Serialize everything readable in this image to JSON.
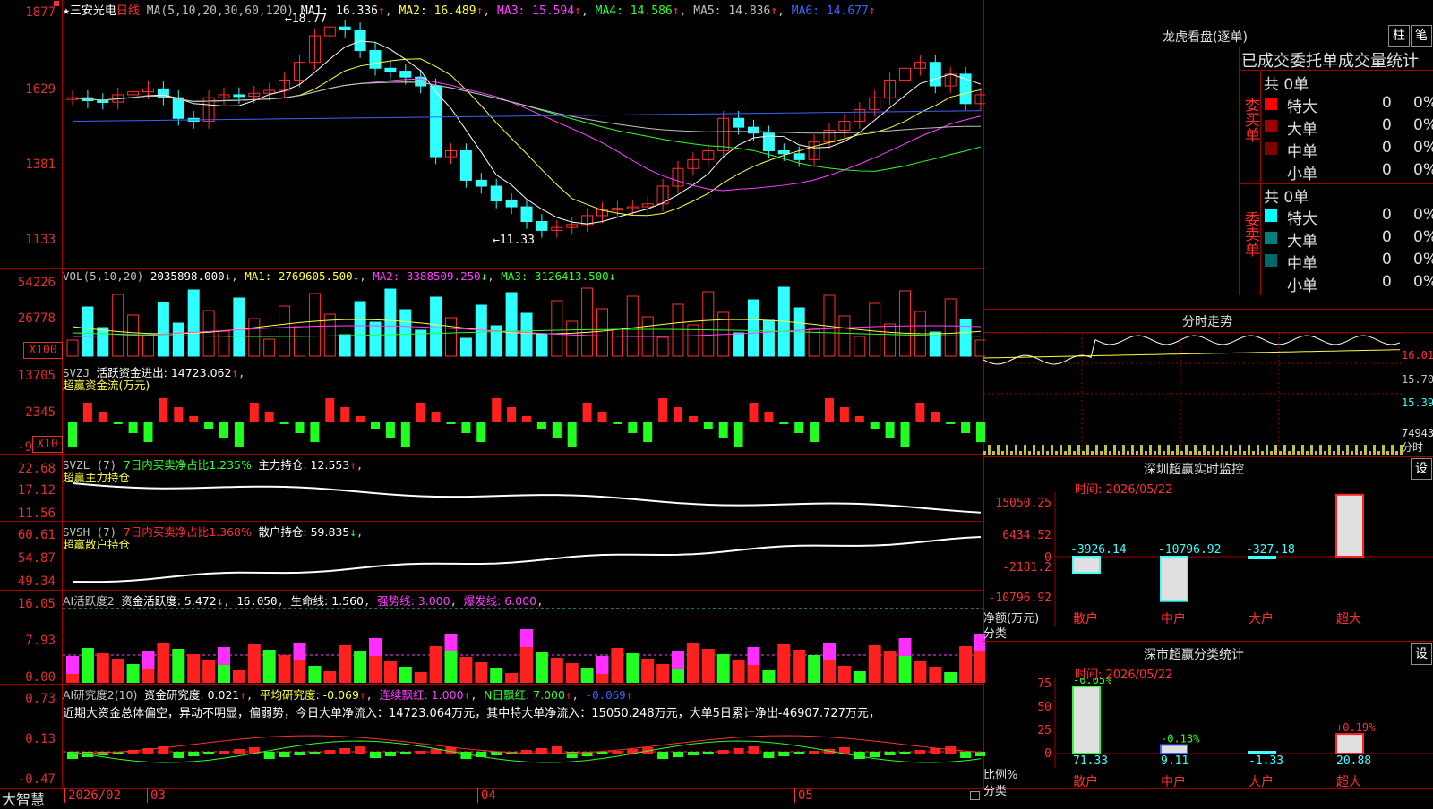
{
  "stock": {
    "name": "三安光电",
    "period": "日线",
    "ma_params": "MA(5,10,20,30,60,120)",
    "ma1": "MA1: 16.336",
    "ma2": "MA2: 16.489",
    "ma3": "MA3: 15.594",
    "ma4": "MA4: 14.586",
    "ma5": "MA5: 14.836",
    "ma6": "MA6: 14.677",
    "high_mark": "18.77",
    "low_mark": "11.33",
    "up_arrow": "↑",
    "down_arrow": "↓"
  },
  "price_axis": [
    "1877",
    "1629",
    "1381",
    "1133"
  ],
  "vol": {
    "params": "VOL(5,10,20)",
    "value": "2035898.000",
    "ma1": "MA1: 2769605.500",
    "ma2": "MA2: 3388509.250",
    "ma3": "MA3: 3126413.500",
    "axis": [
      "54226",
      "26778"
    ],
    "unit": "X100"
  },
  "svzj": {
    "title": "SVZJ",
    "label": "活跃资金进出: 14723.062",
    "sub": "超赢资金流(万元)",
    "axis": [
      "13705",
      "2345",
      "-9"
    ],
    "unit": "X10"
  },
  "svzl": {
    "title": "SVZL (7)",
    "label1": "7日内买卖净占比1.235%",
    "label2": "主力持仓: 12.553",
    "sub": "超赢主力持仓",
    "axis": [
      "22.68",
      "17.12",
      "11.56"
    ]
  },
  "svsh": {
    "title": "SVSH (7)",
    "label1": "7日内买卖净占比1.368%",
    "label2": "散户持仓: 59.835",
    "sub": "超赢散户持仓",
    "axis": [
      "60.61",
      "54.87",
      "49.34"
    ]
  },
  "ai2": {
    "title": "AI活跃度2",
    "label1": "资金活跃度: 5.472",
    "label2": "16.050",
    "label3": "生命线: 1.560",
    "label4": "强势线: 3.000",
    "label5": "爆发线: 6.000",
    "axis": [
      "16.05",
      "7.93",
      "0.00"
    ]
  },
  "ai_res": {
    "title": "AI研究度2(10)",
    "label1": "资金研究度: 0.021",
    "label2": "平均研究度: -0.069",
    "label3": "连续飘红: 1.000",
    "label4": "N日飘红: 7.000",
    "label5": "-0.069",
    "comment": "近期大资金总体偏空，异动不明显，偏弱势，今日大单净流入：14723.064万元，其中特大单净流入：15050.248万元，大单5日累计净出-46907.727万元，",
    "axis": [
      "0.73",
      "0.13",
      "-0.47"
    ]
  },
  "time_axis": {
    "brand": "大智慧",
    "labels": [
      "2026/02",
      "03",
      "04",
      "05"
    ]
  },
  "dragon": {
    "title": "龙虎看盘(逐单)",
    "btn_bar": "柱",
    "btn_pen": "笔",
    "tabs": [
      "已成交",
      "委托单",
      "成交量统计"
    ],
    "buy": {
      "side": "委买单",
      "total": "共 0单",
      "rows": [
        {
          "name": "特大",
          "count": "0",
          "pct": "0%"
        },
        {
          "name": "大单",
          "count": "0",
          "pct": "0%"
        },
        {
          "name": "中单",
          "count": "0",
          "pct": "0%"
        },
        {
          "name": "小单",
          "count": "0",
          "pct": "0%"
        }
      ]
    },
    "sell": {
      "side": "委卖单",
      "total": "共 0单",
      "rows": [
        {
          "name": "特大",
          "count": "0",
          "pct": "0%"
        },
        {
          "name": "大单",
          "count": "0",
          "pct": "0%"
        },
        {
          "name": "中单",
          "count": "0",
          "pct": "0%"
        },
        {
          "name": "小单",
          "count": "0",
          "pct": "0%"
        }
      ]
    },
    "colors": {
      "buy_xl": "#ff0000",
      "buy_l": "#a00000",
      "buy_m": "#800000",
      "sell_xl": "#00ffff",
      "sell_l": "#008080",
      "sell_m": "#006868"
    }
  },
  "intraday": {
    "title": "分时走势",
    "axis": [
      "16.01",
      "15.70",
      "15.39",
      "74943"
    ],
    "unit": "分时"
  },
  "sz_monitor": {
    "title": "深圳超赢实时监控",
    "btn": "设",
    "time": "时间: 2026/05/22",
    "axis": [
      "15050.25",
      "6434.52",
      "0",
      "-2181.2",
      "-10796.92"
    ],
    "axis_title": "净额(万元)",
    "axis_sub": "分类",
    "bars": [
      {
        "cat": "散户",
        "value": -3926.14,
        "label": "-3926.14"
      },
      {
        "cat": "中户",
        "value": -10796.92,
        "label": "-10796.92"
      },
      {
        "cat": "大户",
        "value": -327.18,
        "label": "-327.18"
      },
      {
        "cat": "超大",
        "value": 15050.25,
        "label": "15050.25"
      }
    ]
  },
  "sz_class": {
    "title": "深市超赢分类统计",
    "btn": "设",
    "time": "时间: 2026/05/22",
    "axis": [
      "75",
      "50",
      "25",
      "0"
    ],
    "axis_title": "比例%",
    "axis_sub": "分类",
    "bars": [
      {
        "cat": "散户",
        "pct": 71.33,
        "label": "71.33",
        "chg": "-0.05%"
      },
      {
        "cat": "中户",
        "pct": 9.11,
        "label": "9.11",
        "chg": "-0.13%"
      },
      {
        "cat": "大户",
        "pct": -1.33,
        "label": "-1.33",
        "chg": ""
      },
      {
        "cat": "超大",
        "pct": 20.88,
        "label": "20.88",
        "chg": "+0.19%"
      }
    ]
  }
}
